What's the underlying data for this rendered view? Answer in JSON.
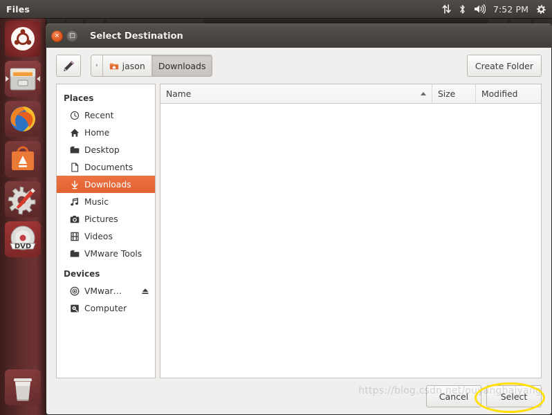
{
  "panel": {
    "app_name": "Files",
    "clock": "7:52 PM",
    "indicators": [
      {
        "name": "network-icon",
        "glyph": "⇅"
      },
      {
        "name": "bluetooth-icon",
        "glyph": "ᛦ"
      },
      {
        "name": "volume-icon",
        "glyph": "🔊"
      },
      {
        "name": "system-menu-icon",
        "glyph": "⚙"
      }
    ]
  },
  "launcher": {
    "items": [
      {
        "name": "ubuntu-dash",
        "label": "Ubuntu Dash"
      },
      {
        "name": "files",
        "label": "Files"
      },
      {
        "name": "firefox",
        "label": "Firefox Web Browser"
      },
      {
        "name": "ubuntu-software",
        "label": "Ubuntu Software"
      },
      {
        "name": "system-settings",
        "label": "System Settings"
      },
      {
        "name": "dvd-drive",
        "label": "DVD"
      },
      {
        "name": "trash",
        "label": "Trash"
      }
    ]
  },
  "dialog": {
    "title": "Select Destination",
    "window_buttons": {
      "close": "×",
      "maximize": "□"
    },
    "toolbar": {
      "edit_location_icon": "pencil-icon",
      "create_folder_label": "Create Folder",
      "breadcrumb": {
        "back_glyph": "‹",
        "items": [
          {
            "label": "jason",
            "icon": "home-folder-icon",
            "active": false
          },
          {
            "label": "Downloads",
            "icon": "",
            "active": true
          }
        ]
      }
    },
    "sidebar": {
      "sections": [
        {
          "heading": "Places",
          "items": [
            {
              "label": "Recent",
              "icon": "clock-icon",
              "selected": false
            },
            {
              "label": "Home",
              "icon": "house-icon",
              "selected": false
            },
            {
              "label": "Desktop",
              "icon": "folder-icon",
              "selected": false
            },
            {
              "label": "Documents",
              "icon": "document-icon",
              "selected": false
            },
            {
              "label": "Downloads",
              "icon": "download-arrow-icon",
              "selected": true
            },
            {
              "label": "Music",
              "icon": "music-note-icon",
              "selected": false
            },
            {
              "label": "Pictures",
              "icon": "camera-icon",
              "selected": false
            },
            {
              "label": "Videos",
              "icon": "film-icon",
              "selected": false
            },
            {
              "label": "VMware Tools",
              "icon": "folder-icon",
              "selected": false
            }
          ]
        },
        {
          "heading": "Devices",
          "items": [
            {
              "label": "VMwar…",
              "icon": "disc-icon",
              "selected": false,
              "eject": true
            },
            {
              "label": "Computer",
              "icon": "computer-icon",
              "selected": false
            }
          ]
        }
      ]
    },
    "file_list": {
      "columns": [
        {
          "label": "Name",
          "sorted": "ascending"
        },
        {
          "label": "Size",
          "sorted": ""
        },
        {
          "label": "Modified",
          "sorted": ""
        }
      ],
      "rows": []
    },
    "actions": {
      "cancel_label": "Cancel",
      "select_label": "Select"
    }
  },
  "watermark": "https://blog.csdn.net/ouyanghaiyang",
  "colors": {
    "panel_bg": "#46423d",
    "launcher_bg": "#5d2b2b",
    "selection_orange": "#e2612f",
    "dialog_bg": "#f0efee",
    "highlight_yellow": "#ffe000"
  }
}
